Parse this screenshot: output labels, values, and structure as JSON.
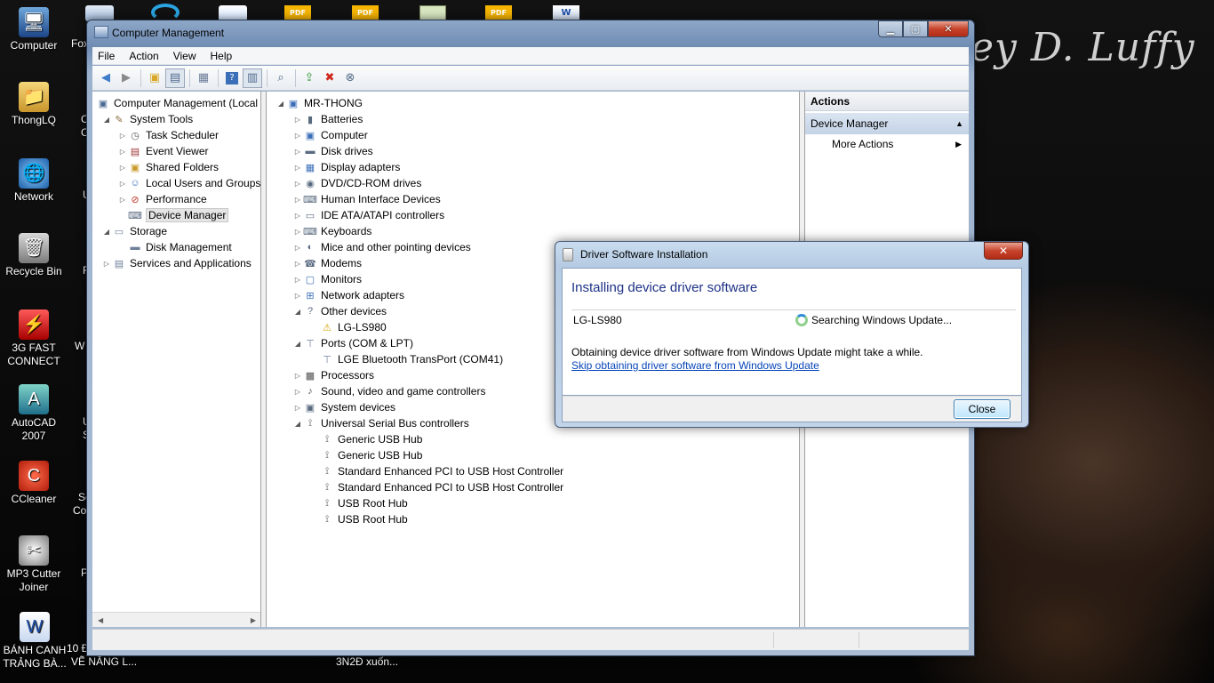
{
  "desktop": {
    "wallpaper_title": "ey D. Luffy",
    "icons": [
      {
        "label": "Computer",
        "icon": "computer-icon"
      },
      {
        "label": "ThongLQ",
        "icon": "user-folder-icon"
      },
      {
        "label": "Network",
        "icon": "network-icon"
      },
      {
        "label": "Recycle Bin",
        "icon": "recycle-bin-icon"
      },
      {
        "label": "3G FAST CONNECT",
        "icon": "3g-connect-icon"
      },
      {
        "label": "AutoCAD 2007",
        "icon": "autocad-icon"
      },
      {
        "label": "CCleaner",
        "icon": "ccleaner-icon"
      },
      {
        "label": "MP3 Cutter Joiner",
        "icon": "mp3-cutter-icon"
      },
      {
        "label": "BÁNH CANH TRẢNG BÀ...",
        "icon": "word-document-icon"
      }
    ],
    "partial_labels": [
      "Fox",
      "C",
      "C",
      "U",
      "F",
      "W",
      "U",
      "S",
      "Se",
      "Co",
      "P"
    ],
    "bottom_labels": [
      "10 Đ",
      "VẼ NĂNG L...",
      "3N2Đ xuốn..."
    ]
  },
  "window": {
    "title": "Computer Management",
    "menu": [
      {
        "label": "File"
      },
      {
        "label": "Action"
      },
      {
        "label": "View"
      },
      {
        "label": "Help"
      }
    ]
  },
  "left_tree": [
    {
      "label": "Computer Management (Local",
      "icon": "computer-management-icon"
    },
    {
      "label": "System Tools",
      "icon": "system-tools-icon"
    },
    {
      "label": "Task Scheduler",
      "icon": "task-scheduler-icon"
    },
    {
      "label": "Event Viewer",
      "icon": "event-viewer-icon"
    },
    {
      "label": "Shared Folders",
      "icon": "shared-folders-icon"
    },
    {
      "label": "Local Users and Groups",
      "icon": "users-groups-icon"
    },
    {
      "label": "Performance",
      "icon": "performance-icon"
    },
    {
      "label": "Device Manager",
      "icon": "device-manager-icon"
    },
    {
      "label": "Storage",
      "icon": "storage-icon"
    },
    {
      "label": "Disk Management",
      "icon": "disk-management-icon"
    },
    {
      "label": "Services and Applications",
      "icon": "services-icon"
    }
  ],
  "device_tree": [
    {
      "label": "MR-THONG",
      "icon": "computer-icon"
    },
    {
      "label": "Batteries",
      "icon": "battery-icon"
    },
    {
      "label": "Computer",
      "icon": "computer-icon"
    },
    {
      "label": "Disk drives",
      "icon": "disk-drive-icon"
    },
    {
      "label": "Display adapters",
      "icon": "display-adapter-icon"
    },
    {
      "label": "DVD/CD-ROM drives",
      "icon": "dvd-icon"
    },
    {
      "label": "Human Interface Devices",
      "icon": "hid-icon"
    },
    {
      "label": "IDE ATA/ATAPI controllers",
      "icon": "ide-icon"
    },
    {
      "label": "Keyboards",
      "icon": "keyboard-icon"
    },
    {
      "label": "Mice and other pointing devices",
      "icon": "mouse-icon"
    },
    {
      "label": "Modems",
      "icon": "modem-icon"
    },
    {
      "label": "Monitors",
      "icon": "monitor-icon"
    },
    {
      "label": "Network adapters",
      "icon": "network-adapter-icon"
    },
    {
      "label": "Other devices",
      "icon": "other-devices-icon"
    },
    {
      "label": "LG-LS980",
      "icon": "warning-device-icon"
    },
    {
      "label": "Ports (COM & LPT)",
      "icon": "port-icon"
    },
    {
      "label": "LGE Bluetooth TransPort (COM41)",
      "icon": "port-icon"
    },
    {
      "label": "Processors",
      "icon": "processor-icon"
    },
    {
      "label": "Sound, video and game controllers",
      "icon": "sound-icon"
    },
    {
      "label": "System devices",
      "icon": "system-device-icon"
    },
    {
      "label": "Universal Serial Bus controllers",
      "icon": "usb-icon"
    },
    {
      "label": "Generic USB Hub",
      "icon": "usb-icon"
    },
    {
      "label": "Generic USB Hub",
      "icon": "usb-icon"
    },
    {
      "label": "Standard Enhanced PCI to USB Host Controller",
      "icon": "usb-icon"
    },
    {
      "label": "Standard Enhanced PCI to USB Host Controller",
      "icon": "usb-icon"
    },
    {
      "label": "USB Root Hub",
      "icon": "usb-icon"
    },
    {
      "label": "USB Root Hub",
      "icon": "usb-icon"
    }
  ],
  "actions": {
    "header": "Actions",
    "group": "Device Manager",
    "item": "More Actions"
  },
  "dialog": {
    "title": "Driver Software Installation",
    "heading": "Installing device driver software",
    "device": "LG-LS980",
    "status": "Searching Windows Update...",
    "note": "Obtaining device driver software from Windows Update might take a while.",
    "link": "Skip obtaining driver software from Windows Update",
    "close_label": "Close"
  },
  "colors": {
    "heading_blue": "#1e3287",
    "link_blue": "#0645b8",
    "close_red": "#c7432b"
  }
}
